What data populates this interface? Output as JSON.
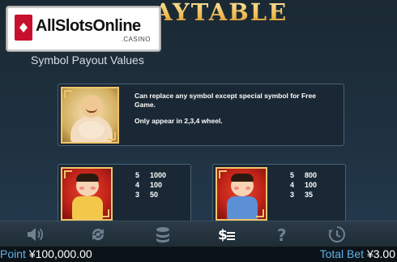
{
  "page": {
    "title": "PAYTABLE",
    "title_visible": "AYTABLE"
  },
  "watermark": {
    "brand": "AllSlotsOnline",
    "sub": ".CASINO",
    "color": "#c8102e"
  },
  "section": {
    "heading": "Symbol Payout Values"
  },
  "wild": {
    "line1": "Can replace any symbol except special symbol for Free Game.",
    "line2": "Only appear in 2,3,4 wheel."
  },
  "symbols": [
    {
      "payouts": [
        {
          "count": "5",
          "amount": "1000"
        },
        {
          "count": "4",
          "amount": "100"
        },
        {
          "count": "3",
          "amount": "50"
        }
      ]
    },
    {
      "payouts": [
        {
          "count": "5",
          "amount": "800"
        },
        {
          "count": "4",
          "amount": "100"
        },
        {
          "count": "3",
          "amount": "35"
        }
      ]
    }
  ],
  "toolbar": {
    "icons": [
      "speaker-icon",
      "autoplay-icon",
      "coins-icon",
      "paytable-icon",
      "help-icon",
      "history-icon"
    ],
    "active": "paytable-icon"
  },
  "status": {
    "point_label": "Point",
    "point_value": "¥100,000.00",
    "bet_label": "Total Bet",
    "bet_value": "¥3.00"
  },
  "colors": {
    "accent_gold": "#f1c56a",
    "label_blue": "#5fb2e9",
    "background": "#1d2c38"
  }
}
